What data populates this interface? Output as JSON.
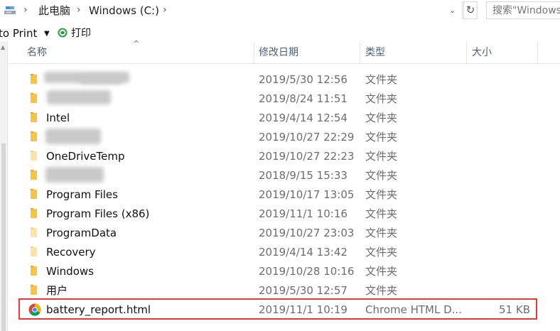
{
  "address": {
    "crumbs": [
      "此电脑",
      "Windows (C:)"
    ],
    "search_placeholder": "搜索\"Windows (C:)\""
  },
  "toolbar": {
    "print_to_label": "to Print",
    "print_label": "打印"
  },
  "columns": {
    "name": "名称",
    "date": "修改日期",
    "type": "类型",
    "size": "大小"
  },
  "colors": {
    "folder": "#f7c443",
    "highlight": "#e8383a",
    "header_text": "#4c607a"
  },
  "rows": [
    {
      "name": "",
      "date": "2019/5/30 12:56",
      "type": "文件夹",
      "size": "",
      "icon": "folder-icon",
      "obscured": true
    },
    {
      "name": "",
      "date": "2019/8/24 11:51",
      "type": "文件夹",
      "size": "",
      "icon": "folder-icon",
      "obscured": true
    },
    {
      "name": "Intel",
      "date": "2019/4/14 12:54",
      "type": "文件夹",
      "size": "",
      "icon": "folder-icon"
    },
    {
      "name": "",
      "date": "2019/10/27 22:29",
      "type": "文件夹",
      "size": "",
      "icon": "folder-icon",
      "obscured": true
    },
    {
      "name": "OneDriveTemp",
      "date": "2019/10/27 22:23",
      "type": "文件夹",
      "size": "",
      "icon": "folder-icon",
      "faded": true
    },
    {
      "name": "",
      "date": "2018/9/15 15:33",
      "type": "文件夹",
      "size": "",
      "icon": "folder-icon",
      "obscured": true
    },
    {
      "name": "Program Files",
      "date": "2019/10/17 13:05",
      "type": "文件夹",
      "size": "",
      "icon": "folder-icon"
    },
    {
      "name": "Program Files (x86)",
      "date": "2019/11/1 10:16",
      "type": "文件夹",
      "size": "",
      "icon": "folder-icon"
    },
    {
      "name": "ProgramData",
      "date": "2019/10/27 23:03",
      "type": "文件夹",
      "size": "",
      "icon": "folder-icon",
      "faded": true
    },
    {
      "name": "Recovery",
      "date": "2019/4/14 13:42",
      "type": "文件夹",
      "size": "",
      "icon": "folder-icon",
      "faded": true
    },
    {
      "name": "Windows",
      "date": "2019/10/28 10:16",
      "type": "文件夹",
      "size": "",
      "icon": "folder-icon"
    },
    {
      "name": "用户",
      "date": "2019/5/30 12:57",
      "type": "文件夹",
      "size": "",
      "icon": "folder-icon"
    },
    {
      "name": "battery_report.html",
      "date": "2019/11/1 10:19",
      "type": "Chrome HTML D...",
      "size": "51 KB",
      "icon": "chrome-icon",
      "highlighted": true
    }
  ]
}
